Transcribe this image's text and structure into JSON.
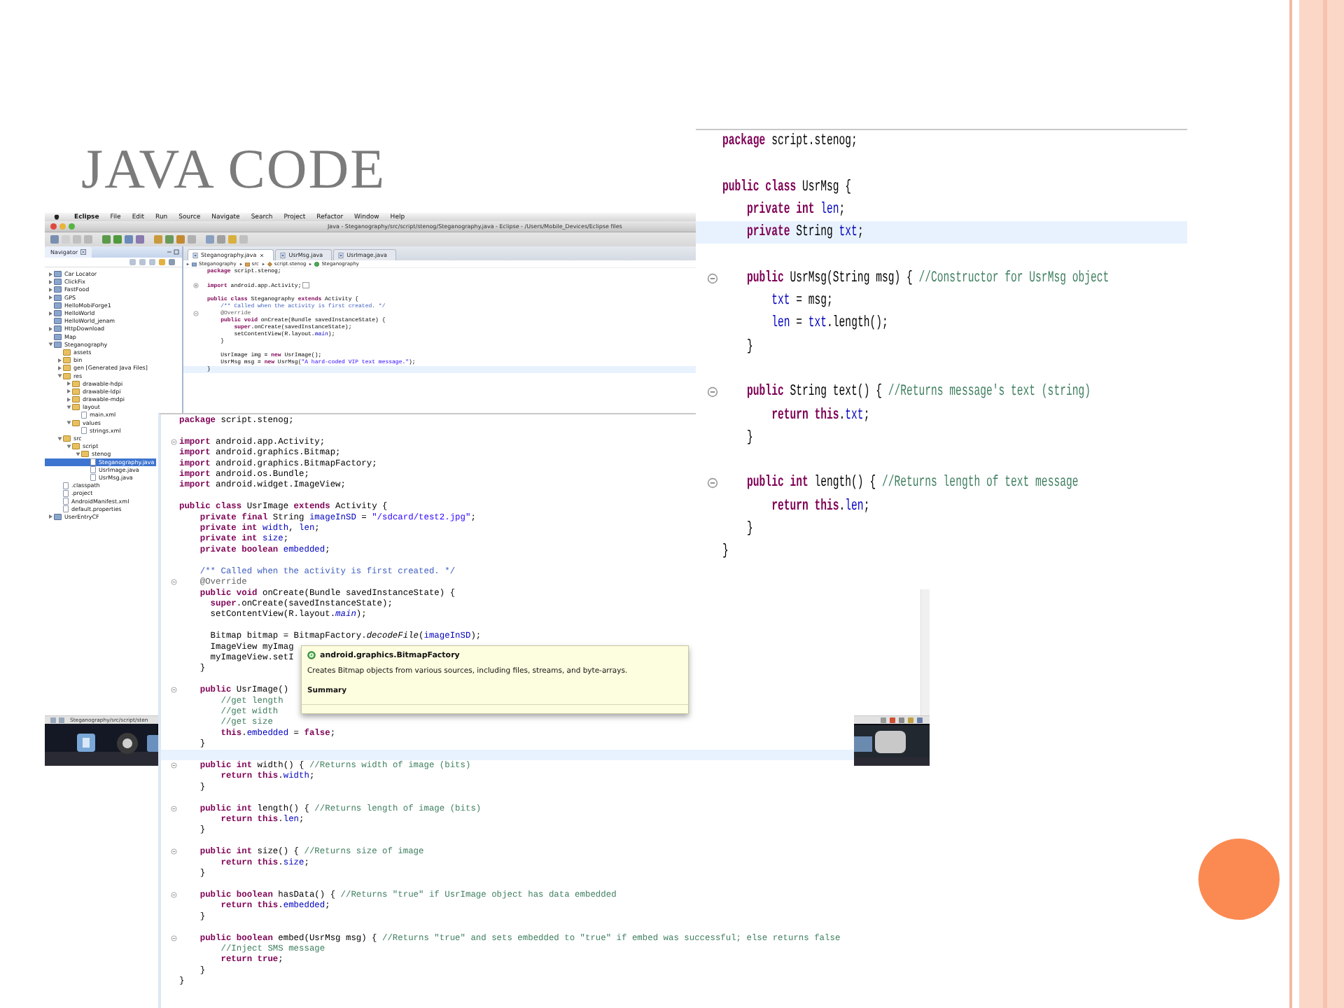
{
  "slide": {
    "title": "JAVA CODE"
  },
  "ide_window": {
    "menu_bar": [
      "Eclipse",
      "File",
      "Edit",
      "Run",
      "Source",
      "Navigate",
      "Search",
      "Project",
      "Refactor",
      "Window",
      "Help"
    ],
    "title": "Java - Steganography/src/script/stenog/Steganography.java - Eclipse - /Users/Mobile_Devices/Eclipse files",
    "navigator": {
      "title": "Navigator",
      "tree": [
        {
          "label": "Car Locator",
          "kind": "project",
          "expanded": false,
          "selected": false
        },
        {
          "label": "ClickFix",
          "kind": "project",
          "expanded": false,
          "selected": false
        },
        {
          "label": "FastFood",
          "kind": "project",
          "expanded": false,
          "selected": false
        },
        {
          "label": "GPS",
          "kind": "project",
          "expanded": false,
          "selected": false
        },
        {
          "label": "HelloMobiForge1",
          "kind": "project",
          "selected": false
        },
        {
          "label": "HelloWorld",
          "kind": "project",
          "expanded": false,
          "selected": false
        },
        {
          "label": "HelloWorld_jenam",
          "kind": "project",
          "selected": false
        },
        {
          "label": "HttpDownload",
          "kind": "project",
          "expanded": false,
          "selected": false
        },
        {
          "label": "Map",
          "kind": "project",
          "selected": false
        },
        {
          "label": "Steganography",
          "kind": "project",
          "expanded": true,
          "selected": false,
          "children": [
            {
              "label": "assets",
              "kind": "folder",
              "selected": false
            },
            {
              "label": "bin",
              "kind": "folder",
              "expanded": false,
              "selected": false
            },
            {
              "label": "gen [Generated Java Files]",
              "kind": "folder",
              "expanded": false,
              "selected": false
            },
            {
              "label": "res",
              "kind": "folder",
              "expanded": true,
              "selected": false,
              "children": [
                {
                  "label": "drawable-hdpi",
                  "kind": "folder",
                  "expanded": false,
                  "selected": false
                },
                {
                  "label": "drawable-ldpi",
                  "kind": "folder",
                  "expanded": false,
                  "selected": false
                },
                {
                  "label": "drawable-mdpi",
                  "kind": "folder",
                  "expanded": false,
                  "selected": false
                },
                {
                  "label": "layout",
                  "kind": "folder",
                  "expanded": true,
                  "selected": false,
                  "children": [
                    {
                      "label": "main.xml",
                      "kind": "file",
                      "selected": false
                    }
                  ]
                },
                {
                  "label": "values",
                  "kind": "folder",
                  "expanded": true,
                  "selected": false,
                  "children": [
                    {
                      "label": "strings.xml",
                      "kind": "file",
                      "selected": false
                    }
                  ]
                }
              ]
            },
            {
              "label": "src",
              "kind": "folder",
              "expanded": true,
              "selected": false,
              "children": [
                {
                  "label": "script",
                  "kind": "folder",
                  "expanded": true,
                  "selected": false,
                  "children": [
                    {
                      "label": "stenog",
                      "kind": "folder",
                      "expanded": true,
                      "selected": false,
                      "children": [
                        {
                          "label": "Steganography.java",
                          "kind": "file",
                          "selected": true
                        },
                        {
                          "label": "UsrImage.java",
                          "kind": "file",
                          "selected": false
                        },
                        {
                          "label": "UsrMsg.java",
                          "kind": "file",
                          "selected": false
                        }
                      ]
                    }
                  ]
                }
              ]
            },
            {
              "label": ".classpath",
              "kind": "file",
              "selected": false
            },
            {
              "label": ".project",
              "kind": "file",
              "selected": false
            },
            {
              "label": "AndroidManifest.xml",
              "kind": "file",
              "selected": false
            },
            {
              "label": "default.properties",
              "kind": "file",
              "selected": false
            }
          ]
        },
        {
          "label": "UserEntryCF",
          "kind": "project",
          "expanded": false,
          "selected": false
        }
      ]
    },
    "editor_tabs": [
      {
        "label": "Steganography.java",
        "selected": true
      },
      {
        "label": "UsrMsg.java",
        "selected": false
      },
      {
        "label": "UsrImage.java",
        "selected": false
      }
    ],
    "breadcrumb": [
      {
        "label": "Steganography",
        "kind": "project"
      },
      {
        "label": "src",
        "kind": "source-folder"
      },
      {
        "label": "script.stenog",
        "kind": "package"
      },
      {
        "label": "Steganography",
        "kind": "class"
      }
    ],
    "lines": [
      {
        "segments": [
          {
            "text": "package",
            "kind": "keyword"
          },
          {
            "text": " script.stenog;"
          }
        ]
      },
      {
        "blank": true
      },
      {
        "collapsed": true,
        "segments": [
          {
            "text": "import",
            "kind": "keyword"
          },
          {
            "text": " android.app.Activity;"
          }
        ]
      },
      {
        "blank": true
      },
      {
        "segments": [
          {
            "text": "public class",
            "kind": "keyword"
          },
          {
            "text": " Steganography "
          },
          {
            "text": "extends",
            "kind": "keyword"
          },
          {
            "text": " Activity {"
          }
        ]
      },
      {
        "segments": [
          {
            "text": "    /** Called when the activity is first created. */",
            "kind": "javadoc"
          }
        ]
      },
      {
        "collapsed": false,
        "segments": [
          {
            "text": "    @Override",
            "kind": "annotation"
          }
        ]
      },
      {
        "segments": [
          {
            "text": "    public void",
            "kind": "keyword"
          },
          {
            "text": " onCreate(Bundle savedInstanceState) {"
          }
        ]
      },
      {
        "segments": [
          {
            "text": "        super",
            "kind": "keyword"
          },
          {
            "text": ".onCreate(savedInstanceState);"
          }
        ]
      },
      {
        "segments": [
          {
            "text": "        setContentView(R.layout."
          },
          {
            "text": "main",
            "kind": "static"
          },
          {
            "text": ");"
          }
        ]
      },
      {
        "segments": [
          {
            "text": "    }"
          }
        ]
      },
      {
        "blank": true
      },
      {
        "segments": [
          {
            "text": "    UsrImage img = "
          },
          {
            "text": "new",
            "kind": "keyword"
          },
          {
            "text": " UsrImage();"
          }
        ]
      },
      {
        "segments": [
          {
            "text": "    UsrMsg msg = "
          },
          {
            "text": "new",
            "kind": "keyword"
          },
          {
            "text": " UsrMsg("
          },
          {
            "text": "\"A hard-coded VIP text message.\"",
            "kind": "string"
          },
          {
            "text": ");"
          }
        ]
      },
      {
        "current": true,
        "segments": [
          {
            "text": "}"
          }
        ]
      }
    ],
    "status_text": "Steganography/src/script/sten"
  },
  "usrimage_panel": {
    "lines": [
      {
        "segments": [
          {
            "text": "package",
            "kind": "keyword"
          },
          {
            "text": " script.stenog;"
          }
        ]
      },
      {
        "blank": true
      },
      {
        "collapsed": false,
        "segments": [
          {
            "text": "import",
            "kind": "keyword"
          },
          {
            "text": " android.app.Activity;"
          }
        ]
      },
      {
        "segments": [
          {
            "text": "import",
            "kind": "keyword"
          },
          {
            "text": " android.graphics.Bitmap;"
          }
        ]
      },
      {
        "segments": [
          {
            "text": "import",
            "kind": "keyword"
          },
          {
            "text": " android.graphics.BitmapFactory;"
          }
        ]
      },
      {
        "segments": [
          {
            "text": "import",
            "kind": "keyword"
          },
          {
            "text": " android.os.Bundle;"
          }
        ]
      },
      {
        "segments": [
          {
            "text": "import",
            "kind": "keyword"
          },
          {
            "text": " android.widget.ImageView;"
          }
        ]
      },
      {
        "blank": true
      },
      {
        "segments": [
          {
            "text": "public class",
            "kind": "keyword"
          },
          {
            "text": " UsrImage "
          },
          {
            "text": "extends",
            "kind": "keyword"
          },
          {
            "text": " Activity {"
          }
        ]
      },
      {
        "segments": [
          {
            "text": "    private final",
            "kind": "keyword"
          },
          {
            "text": " String "
          },
          {
            "text": "imageInSD",
            "kind": "field"
          },
          {
            "text": " = "
          },
          {
            "text": "\"/sdcard/test2.jpg\"",
            "kind": "string"
          },
          {
            "text": ";"
          }
        ]
      },
      {
        "segments": [
          {
            "text": "    private int ",
            "kind": "keyword"
          },
          {
            "text": "width",
            "kind": "field"
          },
          {
            "text": ", "
          },
          {
            "text": "len",
            "kind": "field"
          },
          {
            "text": ";"
          }
        ]
      },
      {
        "segments": [
          {
            "text": "    private int ",
            "kind": "keyword"
          },
          {
            "text": "size",
            "kind": "field"
          },
          {
            "text": ";"
          }
        ]
      },
      {
        "segments": [
          {
            "text": "    private boolean ",
            "kind": "keyword"
          },
          {
            "text": "embedded",
            "kind": "field"
          },
          {
            "text": ";"
          }
        ]
      },
      {
        "blank": true
      },
      {
        "segments": [
          {
            "text": "    /** Called when the activity is first created. */",
            "kind": "javadoc"
          }
        ]
      },
      {
        "collapsed": false,
        "segments": [
          {
            "text": "    @Override",
            "kind": "annotation"
          }
        ]
      },
      {
        "segments": [
          {
            "text": "    public void",
            "kind": "keyword"
          },
          {
            "text": " onCreate(Bundle savedInstanceState) {"
          }
        ]
      },
      {
        "segments": [
          {
            "text": "      super",
            "kind": "keyword"
          },
          {
            "text": ".onCreate(savedInstanceState);"
          }
        ]
      },
      {
        "segments": [
          {
            "text": "      setContentView(R.layout."
          },
          {
            "text": "main",
            "kind": "static"
          },
          {
            "text": ");"
          }
        ]
      },
      {
        "blank": true
      },
      {
        "segments": [
          {
            "text": "      Bitmap bitmap = BitmapFactory."
          },
          {
            "text": "decodeFile",
            "kind": "static-method"
          },
          {
            "text": "("
          },
          {
            "text": "imageInSD",
            "kind": "field"
          },
          {
            "text": ");"
          }
        ]
      },
      {
        "segments": [
          {
            "text": "      ImageView myImag"
          }
        ]
      },
      {
        "segments": [
          {
            "text": "      myImageView.setI"
          }
        ]
      },
      {
        "segments": [
          {
            "text": "    }"
          }
        ]
      },
      {
        "blank": true
      },
      {
        "collapsed": false,
        "segments": [
          {
            "text": "    public",
            "kind": "keyword"
          },
          {
            "text": " UsrImage()"
          }
        ]
      },
      {
        "segments": [
          {
            "text": "        //get length",
            "kind": "comment"
          }
        ]
      },
      {
        "segments": [
          {
            "text": "        //get width",
            "kind": "comment"
          }
        ]
      },
      {
        "segments": [
          {
            "text": "        //get size",
            "kind": "comment"
          }
        ]
      },
      {
        "segments": [
          {
            "text": "        this",
            "kind": "keyword"
          },
          {
            "text": "."
          },
          {
            "text": "embedded",
            "kind": "field"
          },
          {
            "text": " = "
          },
          {
            "text": "false",
            "kind": "keyword"
          },
          {
            "text": ";"
          }
        ]
      },
      {
        "segments": [
          {
            "text": "    }"
          }
        ]
      },
      {
        "blank": true,
        "current": true
      },
      {
        "collapsed": false,
        "segments": [
          {
            "text": "    public int",
            "kind": "keyword"
          },
          {
            "text": " width() { "
          },
          {
            "text": "//Returns width of image (bits)",
            "kind": "comment"
          }
        ]
      },
      {
        "segments": [
          {
            "text": "        return this",
            "kind": "keyword"
          },
          {
            "text": "."
          },
          {
            "text": "width",
            "kind": "field"
          },
          {
            "text": ";"
          }
        ]
      },
      {
        "segments": [
          {
            "text": "    }"
          }
        ]
      },
      {
        "blank": true
      },
      {
        "collapsed": false,
        "segments": [
          {
            "text": "    public int",
            "kind": "keyword"
          },
          {
            "text": " length() { "
          },
          {
            "text": "//Returns length of image (bits)",
            "kind": "comment"
          }
        ]
      },
      {
        "segments": [
          {
            "text": "        return this",
            "kind": "keyword"
          },
          {
            "text": "."
          },
          {
            "text": "len",
            "kind": "field"
          },
          {
            "text": ";"
          }
        ]
      },
      {
        "segments": [
          {
            "text": "    }"
          }
        ]
      },
      {
        "blank": true
      },
      {
        "collapsed": false,
        "segments": [
          {
            "text": "    public int",
            "kind": "keyword"
          },
          {
            "text": " size() { "
          },
          {
            "text": "//Returns size of image",
            "kind": "comment"
          }
        ]
      },
      {
        "segments": [
          {
            "text": "        return this",
            "kind": "keyword"
          },
          {
            "text": "."
          },
          {
            "text": "size",
            "kind": "field"
          },
          {
            "text": ";"
          }
        ]
      },
      {
        "segments": [
          {
            "text": "    }"
          }
        ]
      },
      {
        "blank": true
      },
      {
        "collapsed": false,
        "segments": [
          {
            "text": "    public boolean",
            "kind": "keyword"
          },
          {
            "text": " hasData() { "
          },
          {
            "text": "//Returns \"true\" if UsrImage object has data embedded",
            "kind": "comment"
          }
        ]
      },
      {
        "segments": [
          {
            "text": "        return this",
            "kind": "keyword"
          },
          {
            "text": "."
          },
          {
            "text": "embedded",
            "kind": "field"
          },
          {
            "text": ";"
          }
        ]
      },
      {
        "segments": [
          {
            "text": "    }"
          }
        ]
      },
      {
        "blank": true
      },
      {
        "collapsed": false,
        "segments": [
          {
            "text": "    public boolean",
            "kind": "keyword"
          },
          {
            "text": " embed(UsrMsg msg) { "
          },
          {
            "text": "//Returns \"true\" and sets embedded to \"true\" if embed was successful; else returns false",
            "kind": "comment"
          }
        ]
      },
      {
        "segments": [
          {
            "text": "        //Inject SMS message",
            "kind": "comment"
          }
        ]
      },
      {
        "segments": [
          {
            "text": "        return true",
            "kind": "keyword"
          },
          {
            "text": ";"
          }
        ]
      },
      {
        "segments": [
          {
            "text": "    }"
          }
        ]
      },
      {
        "segments": [
          {
            "text": "}"
          }
        ]
      }
    ],
    "tooltip": {
      "title": "android.graphics.BitmapFactory",
      "description": "Creates Bitmap objects from various sources, including files, streams, and byte-arrays.",
      "section": "Summary"
    }
  },
  "usrmsg_panel": {
    "lines": [
      {
        "segments": [
          {
            "text": "package",
            "kind": "keyword"
          },
          {
            "text": " script.stenog;"
          }
        ]
      },
      {
        "blank": true
      },
      {
        "segments": [
          {
            "text": "public class",
            "kind": "keyword"
          },
          {
            "text": " UsrMsg {"
          }
        ]
      },
      {
        "segments": [
          {
            "text": "    private int ",
            "kind": "keyword"
          },
          {
            "text": "len",
            "kind": "field"
          },
          {
            "text": ";"
          }
        ]
      },
      {
        "current": true,
        "segments": [
          {
            "text": "    private",
            "kind": "keyword"
          },
          {
            "text": " String "
          },
          {
            "text": "txt",
            "kind": "field"
          },
          {
            "text": ";"
          }
        ]
      },
      {
        "blank": true
      },
      {
        "collapsed": false,
        "segments": [
          {
            "text": "    public",
            "kind": "keyword"
          },
          {
            "text": " UsrMsg(String msg) { "
          },
          {
            "text": "//Constructor for UsrMsg object",
            "kind": "comment"
          }
        ]
      },
      {
        "segments": [
          {
            "text": "        txt",
            "kind": "field"
          },
          {
            "text": " = msg;"
          }
        ]
      },
      {
        "segments": [
          {
            "text": "        len",
            "kind": "field"
          },
          {
            "text": " = "
          },
          {
            "text": "txt",
            "kind": "field"
          },
          {
            "text": ".length();"
          }
        ]
      },
      {
        "segments": [
          {
            "text": "    }"
          }
        ]
      },
      {
        "blank": true
      },
      {
        "collapsed": false,
        "segments": [
          {
            "text": "    public",
            "kind": "keyword"
          },
          {
            "text": " String text() { "
          },
          {
            "text": "//Returns message's text (string)",
            "kind": "comment"
          }
        ]
      },
      {
        "segments": [
          {
            "text": "        return this",
            "kind": "keyword"
          },
          {
            "text": "."
          },
          {
            "text": "txt",
            "kind": "field"
          },
          {
            "text": ";"
          }
        ]
      },
      {
        "segments": [
          {
            "text": "    }"
          }
        ]
      },
      {
        "blank": true
      },
      {
        "collapsed": false,
        "segments": [
          {
            "text": "    public int",
            "kind": "keyword"
          },
          {
            "text": " length() { "
          },
          {
            "text": "//Returns length of text message",
            "kind": "comment"
          }
        ]
      },
      {
        "segments": [
          {
            "text": "        return this",
            "kind": "keyword"
          },
          {
            "text": "."
          },
          {
            "text": "len",
            "kind": "field"
          },
          {
            "text": ";"
          }
        ]
      },
      {
        "segments": [
          {
            "text": "    }"
          }
        ]
      },
      {
        "segments": [
          {
            "text": "}"
          }
        ]
      }
    ]
  }
}
